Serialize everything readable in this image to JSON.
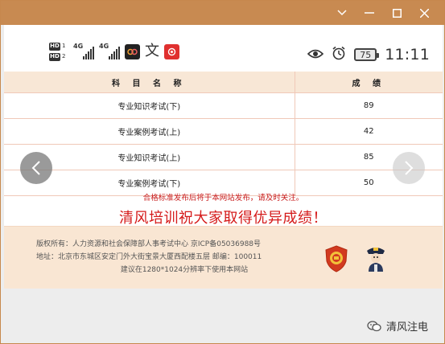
{
  "window": {
    "controls": [
      "chevron-down",
      "minimize",
      "maximize",
      "close"
    ]
  },
  "status_bar": {
    "hd1": "HD",
    "hd1_num": "1",
    "hd2": "HD",
    "hd2_num": "2",
    "signal1_label": "4G",
    "signal2_label": "4G",
    "wen_glyph": "文",
    "battery_level": "75",
    "time": "11:11"
  },
  "table": {
    "headers": [
      "科 目 名 称",
      "成 绩"
    ],
    "rows": [
      {
        "subject": "专业知识考试(下)",
        "score": "89"
      },
      {
        "subject": "专业案例考试(上)",
        "score": "42"
      },
      {
        "subject": "专业知识考试(上)",
        "score": "85"
      },
      {
        "subject": "专业案例考试(下)",
        "score": "50"
      }
    ]
  },
  "note": "合格标准发布后将于本网站发布，请及时关注。",
  "headline": "清风培训祝大家取得优异成绩！",
  "footer": {
    "line1": "版权所有：人力资源和社会保障部人事考试中心 京ICP备05036988号",
    "line2": "地址：北京市东城区安定门外大街宝景大厦西配楼五层 邮编：100011",
    "line3": "建议在1280*1024分辨率下使用本网站"
  },
  "watermark": {
    "text": "清风注电"
  },
  "colors": {
    "titlebar": "#c88a51",
    "table_header": "#f8e7d6",
    "footer": "#f9e6d3",
    "headline_red": "#d51a1a"
  }
}
